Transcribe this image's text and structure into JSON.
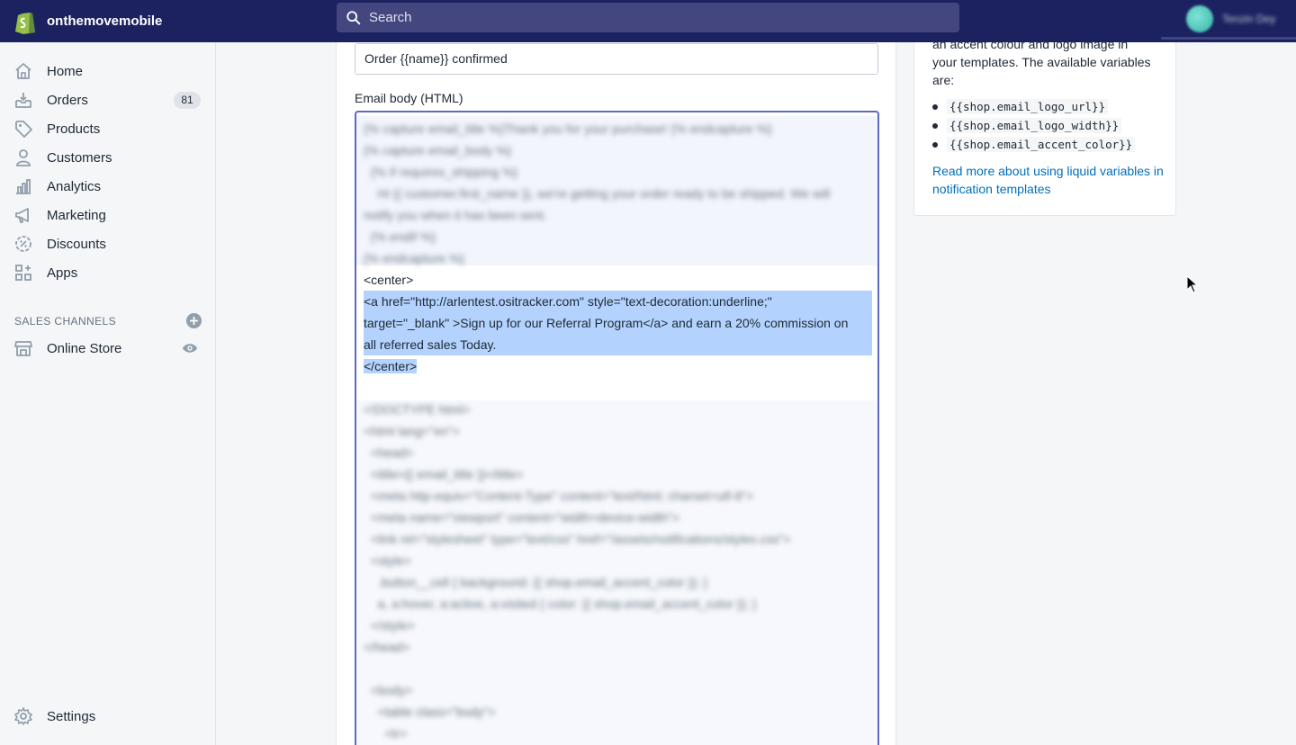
{
  "topbar": {
    "store_name": "onthemovemobile",
    "search_placeholder": "Search",
    "account_name": "Tenzin Dey"
  },
  "sidebar": {
    "items": [
      {
        "label": "Home",
        "icon": "home-icon"
      },
      {
        "label": "Orders",
        "icon": "orders-icon",
        "badge": "81"
      },
      {
        "label": "Products",
        "icon": "tag-icon"
      },
      {
        "label": "Customers",
        "icon": "person-icon"
      },
      {
        "label": "Analytics",
        "icon": "bar-chart-icon"
      },
      {
        "label": "Marketing",
        "icon": "megaphone-icon"
      },
      {
        "label": "Discounts",
        "icon": "discount-icon"
      },
      {
        "label": "Apps",
        "icon": "apps-icon"
      }
    ],
    "channels_title": "SALES CHANNELS",
    "online_store": "Online Store",
    "settings": "Settings"
  },
  "main": {
    "subject_value": "Order {{name}} confirmed",
    "body_label": "Email body (HTML)",
    "blurred_top": [
      "{% capture email_title %}Thank you for your purchase! {% endcapture %}",
      "{% capture email_body %}",
      "  {% if requires_shipping %}",
      "    Hi {{ customer.first_name }}, we're getting your order ready to be shipped. We will",
      "notify you when it has been sent.",
      "  {% endif %}",
      "{% endcapture %}"
    ],
    "code_lines": [
      "<center>",
      "<a href=\"http://arlentest.ositracker.com\" style=\"text-decoration:underline;\"",
      "target=\"_blank\" >Sign up for our Referral Program</a> and earn a 20% commission on",
      "all referred sales Today.",
      "</center>"
    ],
    "blurred_bottom": [
      "<!DOCTYPE html>",
      "<html lang=\"en\">",
      "  <head>",
      "  <title>{{ email_title }}</title>",
      "  <meta http-equiv=\"Content-Type\" content=\"text/html; charset=utf-8\">",
      "  <meta name=\"viewport\" content=\"width=device-width\">",
      "  <link rel=\"stylesheet\" type=\"text/css\" href=\"/assets/notifications/styles.css\">",
      "  <style>",
      "    .button__cell { background: {{ shop.email_accent_color }}; }",
      "    a, a:hover, a:active, a:visited { color: {{ shop.email_accent_color }}; }",
      "  </style>",
      "</head>",
      "",
      "  <body>",
      "    <table class=\"body\">",
      "      <tr>"
    ]
  },
  "side_card": {
    "text_line1": "an accent colour and logo image in",
    "text_line2": "your templates. The available variables",
    "text_line3": "are:",
    "variables": [
      "{{shop.email_logo_url}}",
      "{{shop.email_logo_width}}",
      "{{shop.email_accent_color}}"
    ],
    "link_text": "Read more about using liquid variables in notification templates"
  },
  "colors": {
    "topbar": "#1c2260",
    "selection": "#b3d2fe",
    "focus_border": "#5c6ac4",
    "link": "#006fbb"
  }
}
